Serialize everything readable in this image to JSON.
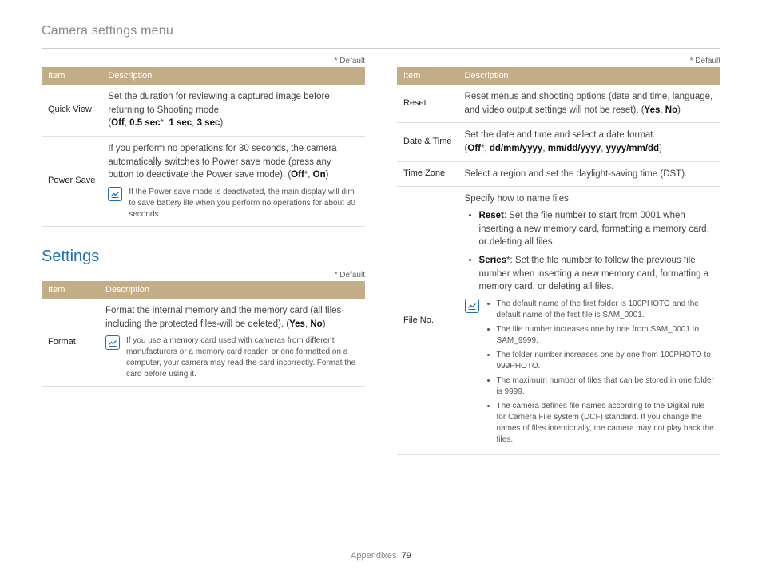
{
  "header": "Camera settings menu",
  "default_note": "* Default",
  "th_item": "Item",
  "th_desc": "Description",
  "section_title": "Settings",
  "footer_section": "Appendixes",
  "footer_page": "79",
  "t1": {
    "r1": {
      "item": "Quick View",
      "line1": "Set the duration for reviewing a captured image before returning to Shooting mode.",
      "opt_open": "(",
      "o1": "Off",
      "c1": ", ",
      "o2": "0.5 sec",
      "star": "*",
      "c2": ", ",
      "o3": "1 sec",
      "c3": ", ",
      "o4": "3 sec",
      "opt_close": ")"
    },
    "r2": {
      "item": "Power Save",
      "line1": "If you perform no operations for 30 seconds, the camera automatically switches to Power save mode (press any button to deactivate the Power save mode). (",
      "o1": "Off",
      "star": "*",
      "c1": ", ",
      "o2": "On",
      "close": ")",
      "note": "If the Power save mode is deactivated, the main display will dim to save battery life when you perform no operations for about 30 seconds."
    }
  },
  "t2": {
    "r1": {
      "item": "Format",
      "line1": "Format the internal memory and the memory card (all files-including the protected files-will be deleted). (",
      "o1": "Yes",
      "c1": ", ",
      "o2": "No",
      "close": ")",
      "note": "If you use a memory card used with cameras from different manufacturers or a memory card reader, or one formatted on a computer, your camera may read the card incorrectly. Format the card before using it."
    }
  },
  "t3": {
    "r1": {
      "item": "Reset",
      "line1": "Reset menus and shooting options (date and time, language, and video output settings will not be reset). (",
      "o1": "Yes",
      "c1": ", ",
      "o2": "No",
      "close": ")"
    },
    "r2": {
      "item": "Date & Time",
      "line1": "Set the date and time and select a date format.",
      "open": "(",
      "o1": "Off",
      "star": "*",
      "c1": ", ",
      "o2": "dd/mm/yyyy",
      "c2": ", ",
      "o3": "mm/dd/yyyy",
      "c3": ", ",
      "o4": "yyyy/mm/dd",
      "close": ")"
    },
    "r3": {
      "item": "Time Zone",
      "line1": "Select a region and set the daylight-saving time (DST)."
    },
    "r4": {
      "item": "File No.",
      "intro": "Specify how to name files.",
      "b1_label": "Reset",
      "b1_text": ": Set the file number to start from 0001 when inserting a new memory card, formatting a memory card, or deleting all files.",
      "b2_label": "Series",
      "b2_star": "*",
      "b2_text": ": Set the file number to follow the previous file number when inserting a new memory card, formatting a memory card, or deleting all files.",
      "n1": "The default name of the first folder is 100PHOTO and the default name of the first file is SAM_0001.",
      "n2": "The file number increases one by one from SAM_0001 to SAM_9999.",
      "n3": "The folder number increases one by one from 100PHOTO to 999PHOTO.",
      "n4": "The maximum number of files that can be stored in one folder is 9999.",
      "n5": "The camera defines file names according to the Digital rule for Camera File system (DCF) standard. If you change the names of files intentionally, the camera may not play back the files."
    }
  }
}
